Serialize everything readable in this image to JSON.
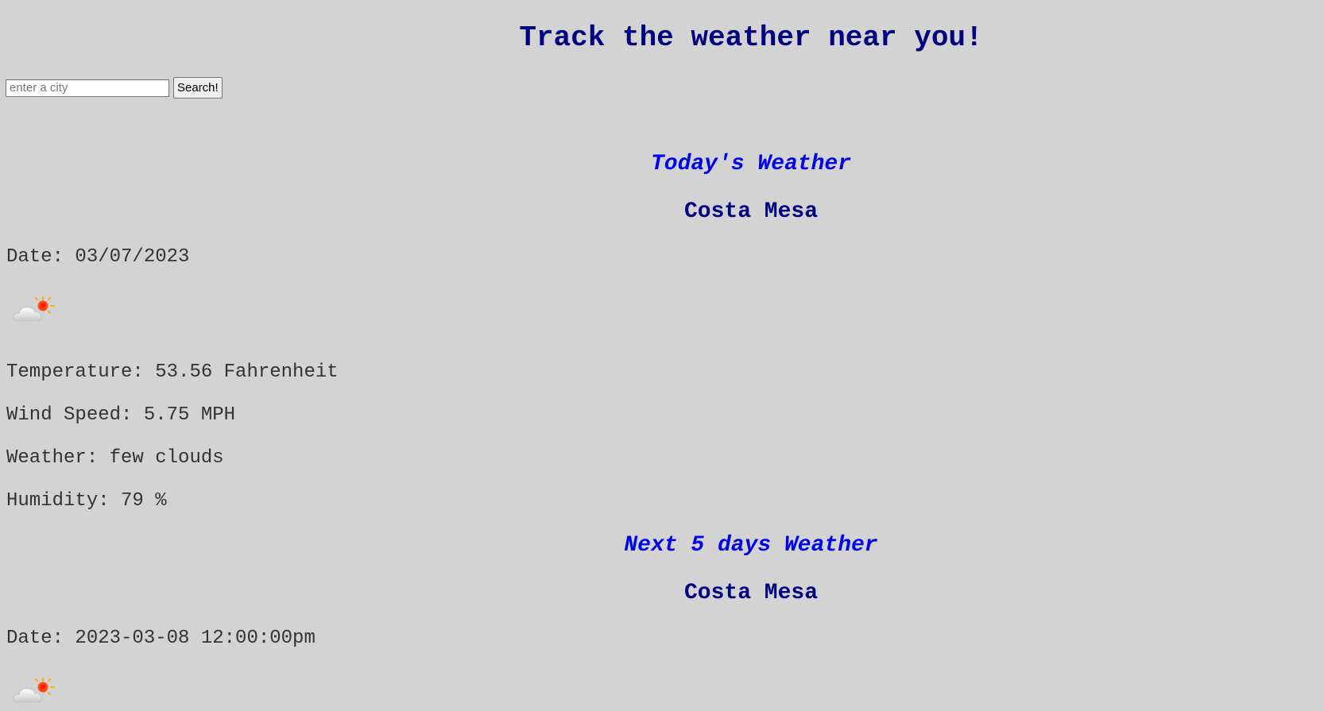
{
  "header": {
    "title": "Track the weather near you!"
  },
  "search": {
    "placeholder": "enter a city",
    "value": "",
    "button_label": "Search!"
  },
  "today": {
    "heading": "Today's Weather",
    "city": "Costa Mesa",
    "date": "Date: 03/07/2023",
    "icon": "few-clouds-icon",
    "temperature": "Temperature: 53.56 Fahrenheit",
    "wind": "Wind Speed: 5.75 MPH",
    "weather": "Weather: few clouds",
    "humidity": "Humidity: 79 %"
  },
  "forecast": {
    "heading": "Next 5 days Weather",
    "city": "Costa Mesa",
    "days": [
      {
        "date": "Date: 2023-03-08 12:00:00pm",
        "icon": "few-clouds-icon"
      }
    ]
  },
  "colors": {
    "background": "#d3d3d3",
    "title": "#000080",
    "section_heading": "#0000ee",
    "body_text": "#333333"
  }
}
